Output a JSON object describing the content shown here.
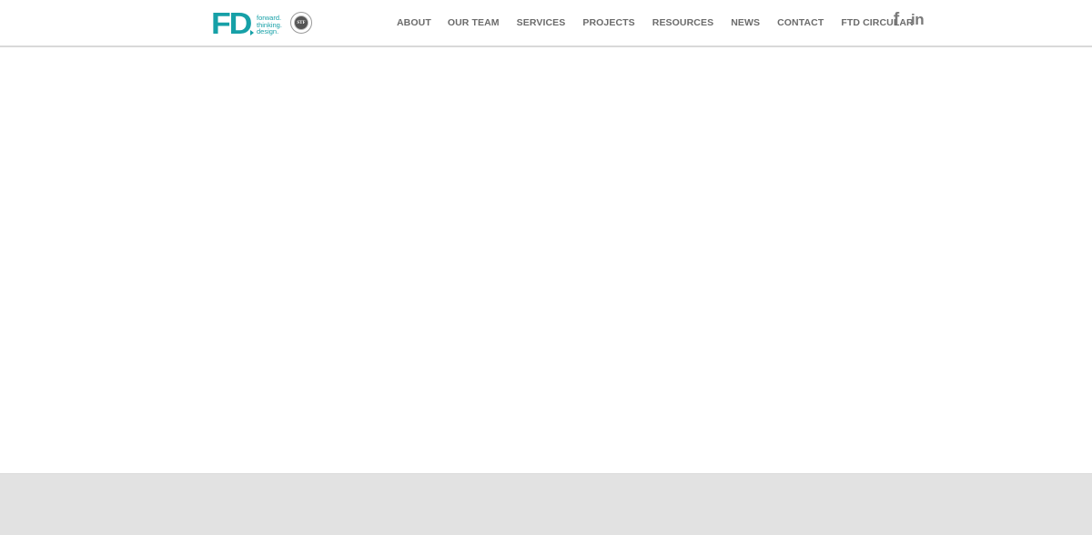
{
  "brand": {
    "logo_mark": "FD",
    "tagline": [
      "forward.",
      "thinking.",
      "design."
    ],
    "seal_text": "STF",
    "accent_color": "#16a0a7"
  },
  "nav": {
    "items": [
      {
        "label": "ABOUT"
      },
      {
        "label": "OUR TEAM"
      },
      {
        "label": "SERVICES"
      },
      {
        "label": "PROJECTS"
      },
      {
        "label": "RESOURCES"
      },
      {
        "label": "NEWS"
      },
      {
        "label": "CONTACT"
      },
      {
        "label": "FTD CIRCULAR"
      }
    ],
    "text_color": "#6b6b6b"
  },
  "social": {
    "facebook_glyph": "f",
    "linkedin_glyph": "in"
  },
  "footer": {
    "background_color": "#e2e2e2"
  }
}
